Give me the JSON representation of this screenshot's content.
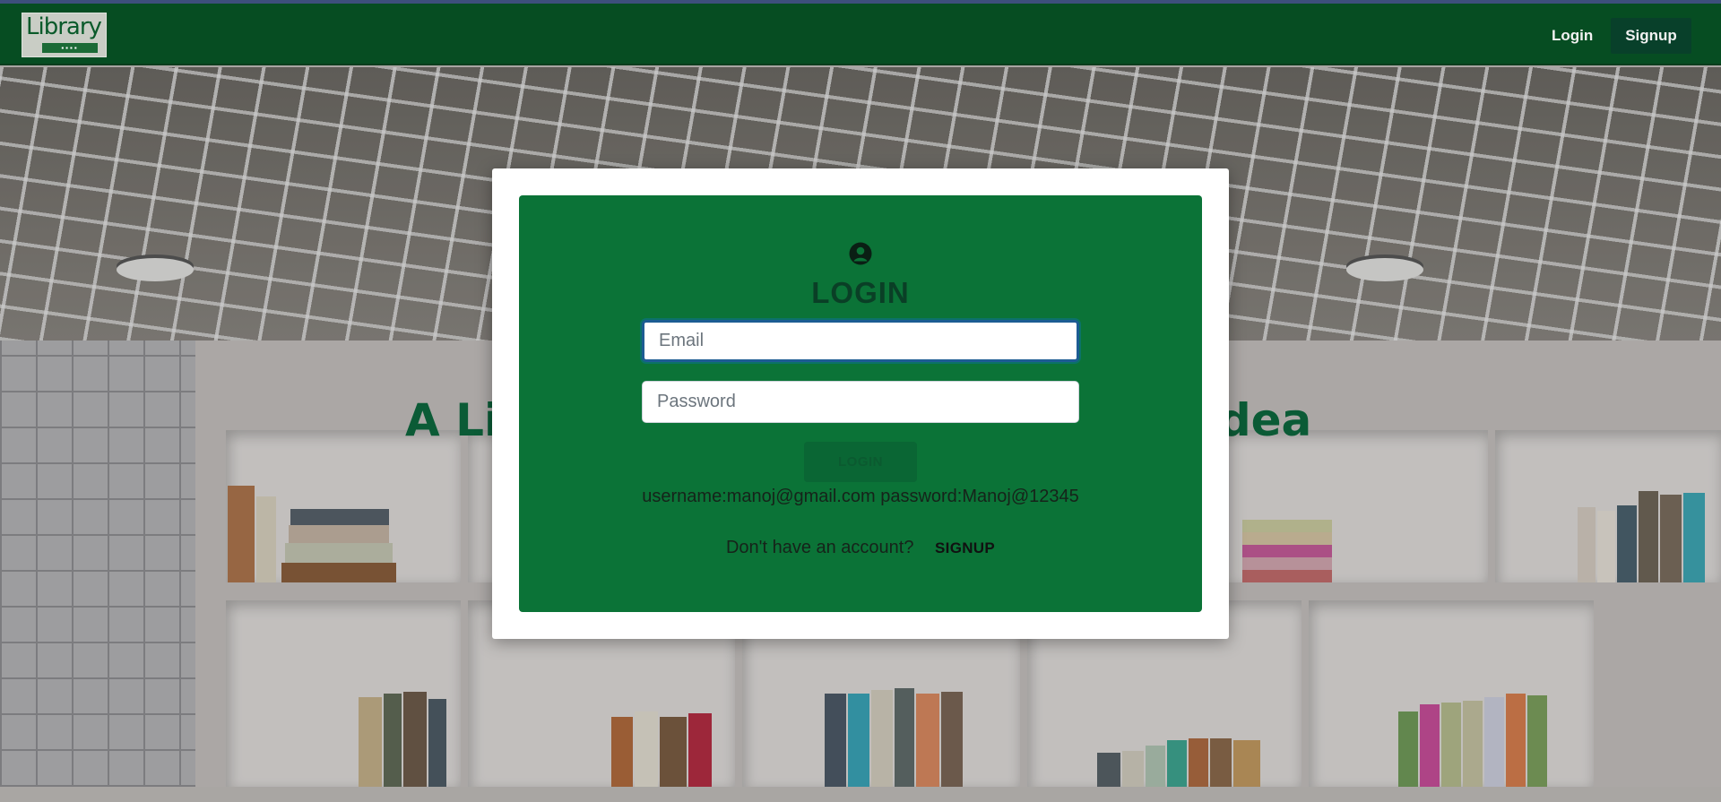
{
  "navbar": {
    "logo_text": "Library",
    "logo_subtext": "▪▪▪▪",
    "login_label": "Login",
    "signup_label": "Signup"
  },
  "hero": {
    "tagline": "A Li                                          n Idea"
  },
  "login_modal": {
    "icon": "user-circle-icon",
    "title": "LOGIN",
    "email_placeholder": "Email",
    "password_placeholder": "Password",
    "submit_label": "LOGIN",
    "credentials_hint": "username:manoj@gmail.com password:Manoj@12345",
    "no_account_text": "Don't have an account?",
    "signup_link_label": "SIGNUP"
  },
  "colors": {
    "navbar": "#064d22",
    "card": "#0b7337",
    "accent_dark": "#0a3f26"
  }
}
